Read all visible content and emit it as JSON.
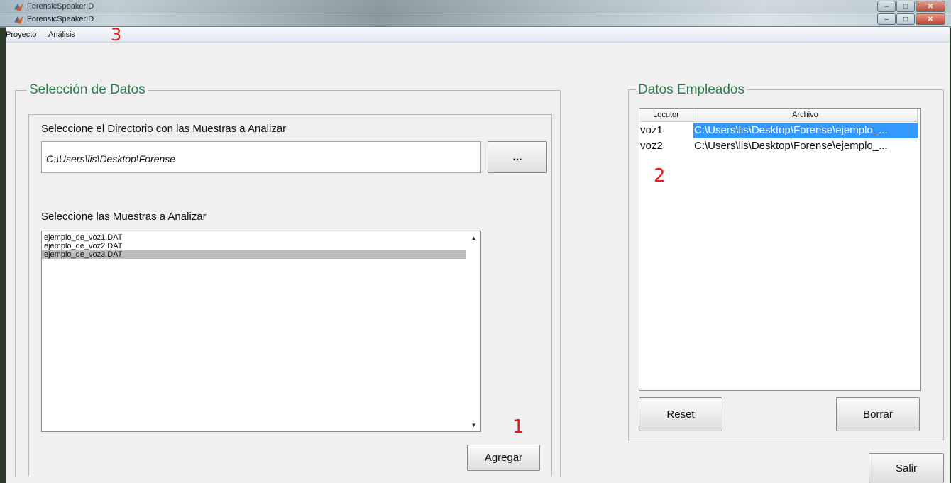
{
  "window": {
    "title": "ForensicSpeakerID",
    "background_title": "ForensicSpeakerID"
  },
  "menubar": {
    "items": [
      "Proyecto",
      "Análisis"
    ]
  },
  "annotations": {
    "one": "1",
    "two": "2",
    "three": "3"
  },
  "left_panel": {
    "title": "Selección de Datos",
    "dir_label": "Seleccione el Directorio con las Muestras a Analizar",
    "dir_value": "C:\\Users\\lis\\Desktop\\Forense",
    "browse_label": "...",
    "samples_label": "Seleccione las Muestras a Analizar",
    "samples": [
      {
        "name": "ejemplo_de_voz1.DAT",
        "selected": false
      },
      {
        "name": "ejemplo_de_voz2.DAT",
        "selected": false
      },
      {
        "name": "ejemplo_de_voz3.DAT",
        "selected": true
      }
    ],
    "add_label": "Agregar"
  },
  "right_panel": {
    "title": "Datos Empleados",
    "table": {
      "headers": [
        "Locutor",
        "Archivo"
      ],
      "rows": [
        {
          "locutor": "voz1",
          "archivo": "C:\\Users\\lis\\Desktop\\Forense\\ejemplo_...",
          "selected": true
        },
        {
          "locutor": "voz2",
          "archivo": "C:\\Users\\lis\\Desktop\\Forense\\ejemplo_...",
          "selected": false
        }
      ]
    },
    "reset_label": "Reset",
    "delete_label": "Borrar"
  },
  "exit_label": "Salir",
  "colors": {
    "group_title": "#2e7b50",
    "selection_blue": "#3399ff",
    "list_selection": "#bdbdbd",
    "annotation_red": "#e31b1b"
  }
}
